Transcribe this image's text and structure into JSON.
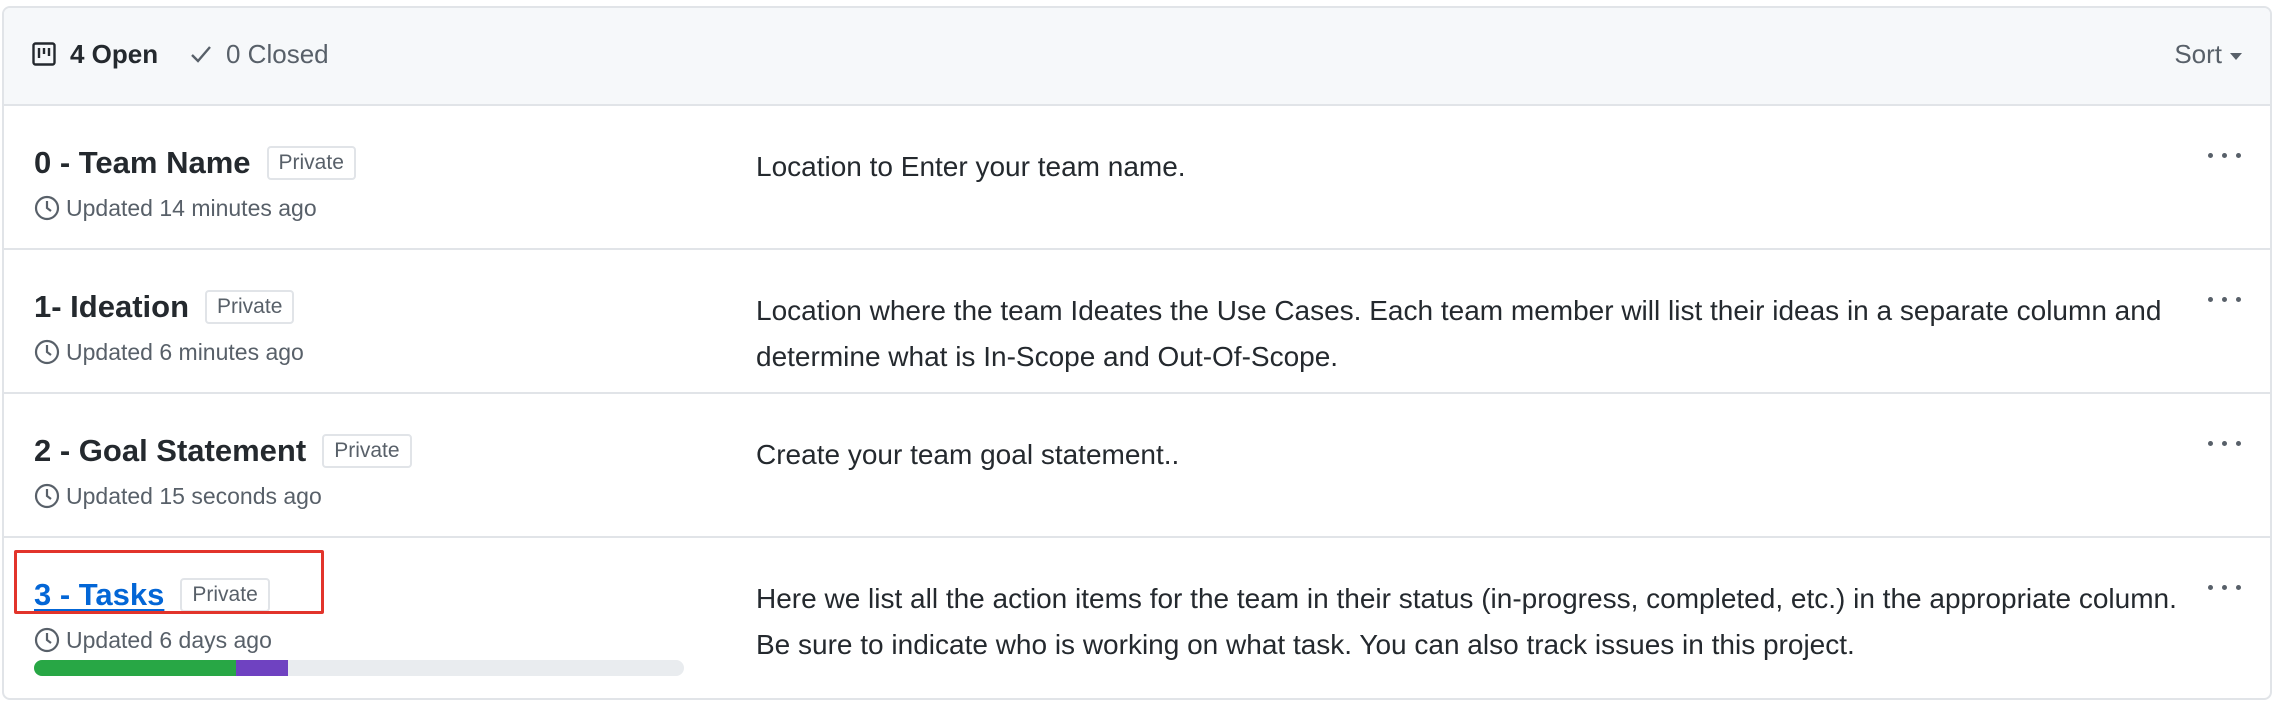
{
  "header": {
    "open_label": "4 Open",
    "closed_label": "0 Closed",
    "sort_label": "Sort"
  },
  "projects": [
    {
      "name": "0 - Team Name",
      "visibility": "Private",
      "updated": "Updated 14 minutes ago",
      "description": "Location to Enter your team name."
    },
    {
      "name": "1- Ideation",
      "visibility": "Private",
      "updated": "Updated 6 minutes ago",
      "description": "Location where the team Ideates the Use Cases. Each team member will list their ideas in a separate column and determine what is In-Scope and Out-Of-Scope."
    },
    {
      "name": "2 - Goal Statement",
      "visibility": "Private",
      "updated": "Updated 15 seconds ago",
      "description": "Create your team goal statement.."
    },
    {
      "name": "3 - Tasks",
      "visibility": "Private",
      "updated": "Updated 6 days ago",
      "description": "Here we list all the action items for the team in their status (in-progress, completed, etc.) in the appropriate column. Be sure to indicate who is working on what task. You can also track issues in this project.",
      "progress": {
        "done_fraction": 0.31,
        "in_progress_fraction": 0.08,
        "done_color": "#28a745",
        "in_progress_color": "#6f42c1",
        "track_color": "#e9ecef"
      }
    }
  ],
  "colors": {
    "link": "#0366d6",
    "highlight_border": "#e2342b"
  },
  "icons": {
    "project": "project-board-icon",
    "check": "check-icon",
    "clock": "clock-icon",
    "kebab": "kebab-horizontal-icon"
  }
}
